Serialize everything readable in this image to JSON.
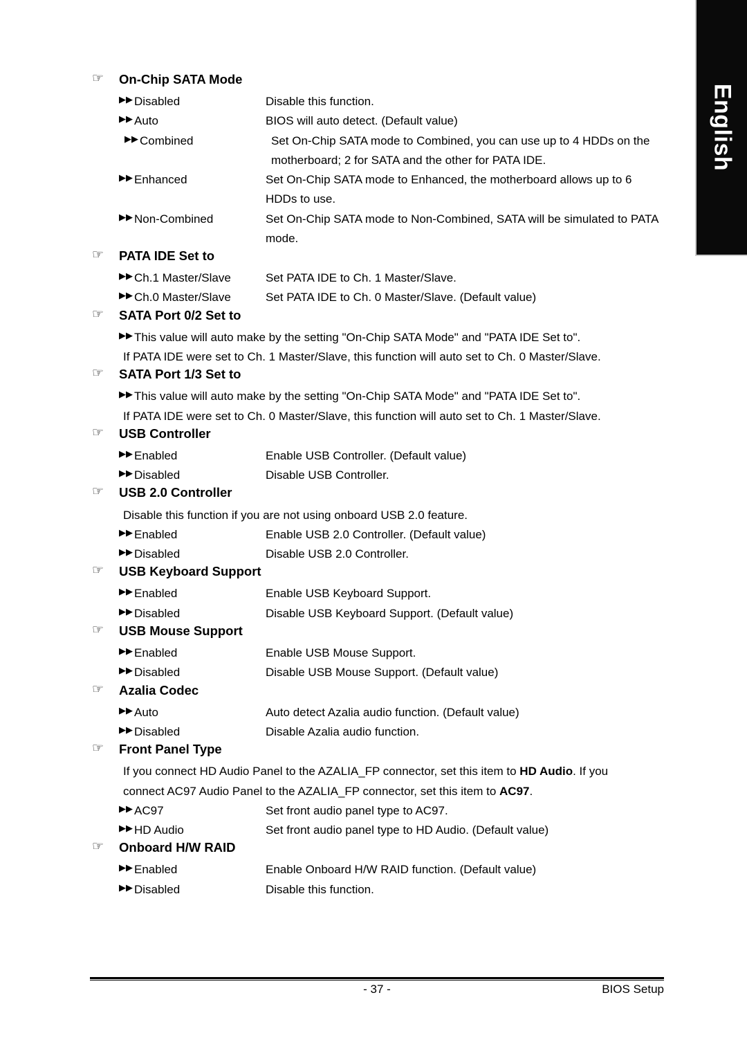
{
  "language_tab": {
    "label": "English"
  },
  "icons": {
    "heading_marker": "☞",
    "option_marker": "▶▶"
  },
  "sections": [
    {
      "id": "on-chip-sata-mode",
      "title": "On-Chip SATA Mode",
      "options": [
        {
          "label": "Disabled",
          "desc": "Disable this function."
        },
        {
          "label": "Auto",
          "desc": "BIOS will auto detect.  (Default value)"
        },
        {
          "label": "Combined",
          "desc": "Set On-Chip SATA mode to Combined, you can use up to 4 HDDs on the motherboard; 2 for SATA and the other for PATA IDE."
        },
        {
          "label": "Enhanced",
          "desc": "Set On-Chip SATA mode to Enhanced, the motherboard allows up to 6 HDDs to use."
        },
        {
          "label": "Non-Combined",
          "desc": "Set On-Chip SATA mode to Non-Combined, SATA will be simulated to PATA mode."
        }
      ]
    },
    {
      "id": "pata-ide-set-to",
      "title": "PATA IDE Set to",
      "options": [
        {
          "label": "Ch.1 Master/Slave",
          "desc": "Set PATA IDE to Ch. 1 Master/Slave."
        },
        {
          "label": "Ch.0 Master/Slave",
          "desc": "Set PATA IDE to Ch. 0 Master/Slave. (Default value)"
        }
      ]
    },
    {
      "id": "sata-port-0-2-set-to",
      "title": "SATA Port 0/2 Set to",
      "bullet_lines": [
        "This value will auto make by the setting \"On-Chip SATA Mode\" and \"PATA IDE Set to\"."
      ],
      "notes": [
        "If PATA IDE were set to Ch. 1 Master/Slave, this function will auto set to Ch. 0 Master/Slave."
      ]
    },
    {
      "id": "sata-port-1-3-set-to",
      "title": "SATA Port 1/3 Set to",
      "bullet_lines": [
        "This value will auto make by the setting \"On-Chip SATA Mode\" and \"PATA IDE Set to\"."
      ],
      "notes": [
        "If PATA IDE were set to Ch. 0 Master/Slave, this function will auto set to Ch. 1 Master/Slave."
      ]
    },
    {
      "id": "usb-controller",
      "title": "USB Controller",
      "options": [
        {
          "label": "Enabled",
          "desc": "Enable USB Controller. (Default value)"
        },
        {
          "label": "Disabled",
          "desc": "Disable USB Controller."
        }
      ]
    },
    {
      "id": "usb-2-0-controller",
      "title": "USB 2.0 Controller",
      "notes": [
        "Disable this function if you are not using onboard USB 2.0 feature."
      ],
      "options": [
        {
          "label": "Enabled",
          "desc": "Enable USB 2.0 Controller. (Default value)"
        },
        {
          "label": "Disabled",
          "desc": "Disable USB 2.0 Controller."
        }
      ]
    },
    {
      "id": "usb-keyboard-support",
      "title": "USB Keyboard Support",
      "options": [
        {
          "label": "Enabled",
          "desc": "Enable USB Keyboard Support."
        },
        {
          "label": "Disabled",
          "desc": "Disable USB Keyboard Support. (Default value)"
        }
      ]
    },
    {
      "id": "usb-mouse-support",
      "title": "USB Mouse Support",
      "options": [
        {
          "label": "Enabled",
          "desc": "Enable USB Mouse Support."
        },
        {
          "label": "Disabled",
          "desc": "Disable USB Mouse Support. (Default value)"
        }
      ]
    },
    {
      "id": "azalia-codec",
      "title": "Azalia Codec",
      "options": [
        {
          "label": "Auto",
          "desc": "Auto detect Azalia audio function. (Default value)"
        },
        {
          "label": "Disabled",
          "desc": "Disable Azalia audio function."
        }
      ]
    },
    {
      "id": "front-panel-type",
      "title": "Front Panel Type",
      "rich_notes": [
        [
          {
            "t": "If you connect HD Audio Panel to the AZALIA_FP connector, set this item to ",
            "b": false
          },
          {
            "t": "HD Audio",
            "b": true
          },
          {
            "t": ". If you",
            "b": false
          }
        ],
        [
          {
            "t": "connect AC97 Audio Panel to the AZALIA_FP connector, set this item to ",
            "b": false
          },
          {
            "t": "AC97",
            "b": true
          },
          {
            "t": ".",
            "b": false
          }
        ]
      ],
      "options": [
        {
          "label": "AC97",
          "desc": "Set front audio panel type to AC97."
        },
        {
          "label": "HD Audio",
          "desc": "Set front audio panel type to HD Audio. (Default value)"
        }
      ]
    },
    {
      "id": "onboard-hw-raid",
      "title": "Onboard H/W RAID",
      "options": [
        {
          "label": "Enabled",
          "desc": "Enable Onboard H/W RAID function. (Default value)"
        },
        {
          "label": "Disabled",
          "desc": "Disable this function."
        }
      ]
    }
  ],
  "footer": {
    "page_number": "- 37 -",
    "right_label": "BIOS Setup"
  }
}
